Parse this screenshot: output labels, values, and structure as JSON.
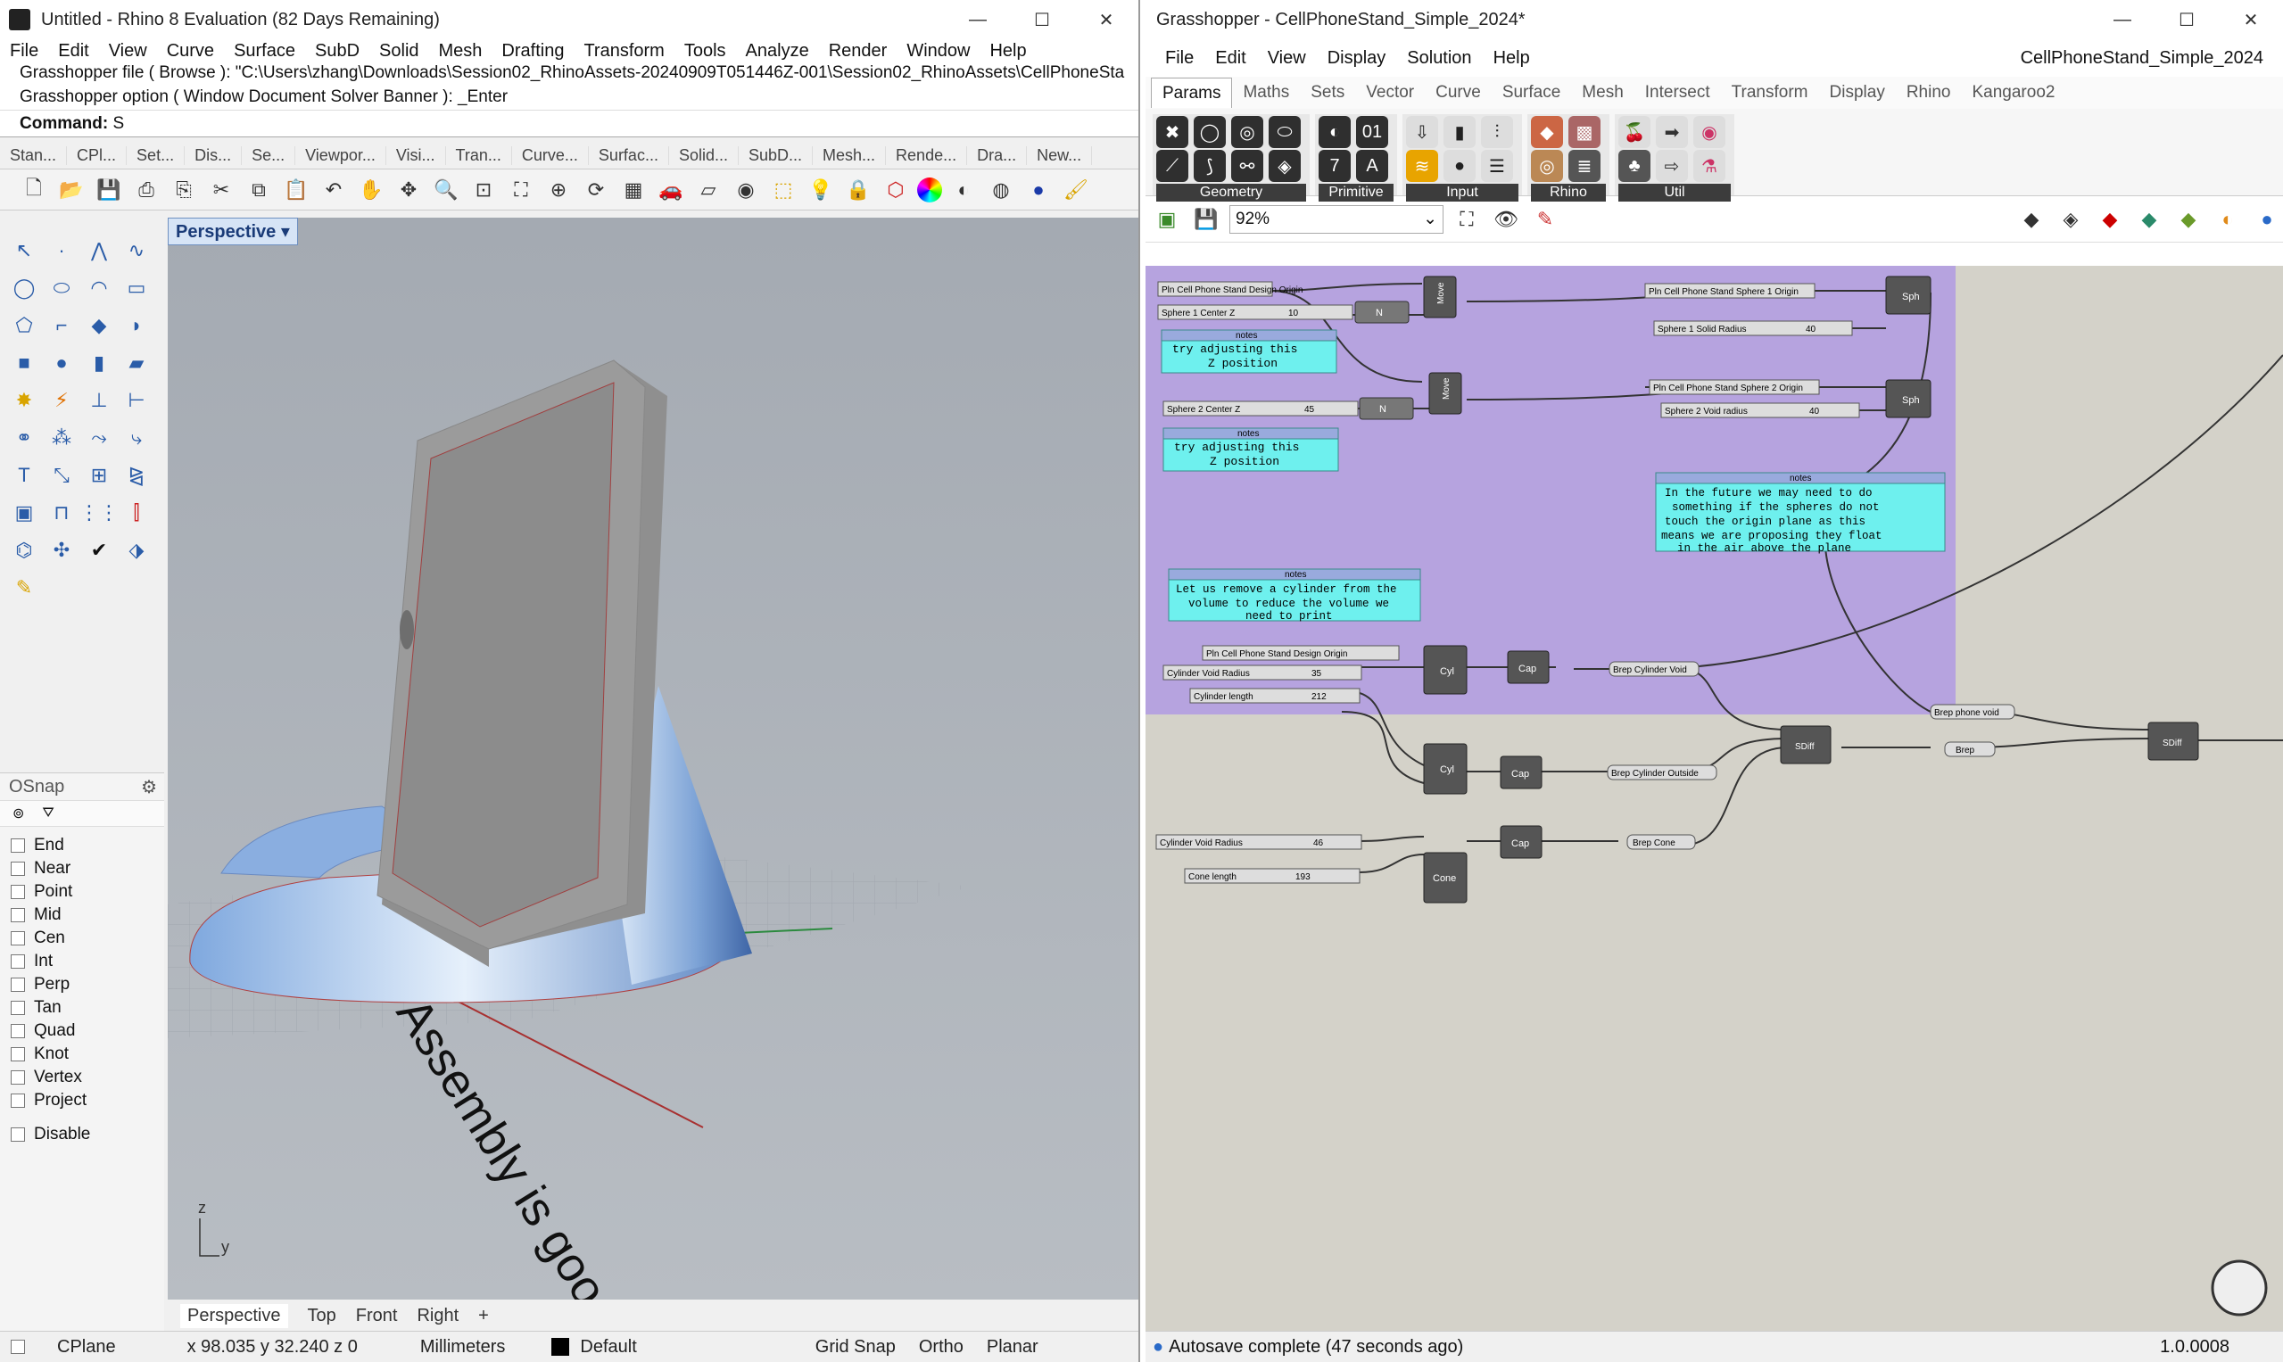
{
  "rhino": {
    "title": "Untitled - Rhino 8 Evaluation (82 Days Remaining)",
    "menu": [
      "File",
      "Edit",
      "View",
      "Curve",
      "Surface",
      "SubD",
      "Solid",
      "Mesh",
      "Drafting",
      "Transform",
      "Tools",
      "Analyze",
      "Render",
      "Window",
      "Help"
    ],
    "history_line1": "Grasshopper file ( Browse ): \"C:\\Users\\zhang\\Downloads\\Session02_RhinoAssets-20240909T051446Z-001\\Session02_RhinoAssets\\CellPhoneSta",
    "history_line2": "Grasshopper option ( Window  Document  Solver  Banner ): _Enter",
    "command_label": "Command:",
    "command_value": "S",
    "toolbar_tabs": [
      "Stan...",
      "CPl...",
      "Set...",
      "Dis...",
      "Se...",
      "Viewpor...",
      "Visi...",
      "Tran...",
      "Curve...",
      "Surfac...",
      "Solid...",
      "SubD...",
      "Mesh...",
      "Rende...",
      "Dra...",
      "New..."
    ],
    "viewport_label": "Perspective",
    "viewport_text": "Assembly is good.",
    "axis_z": "z",
    "axis_y": "y",
    "view_tabs": [
      "Perspective",
      "Top",
      "Front",
      "Right"
    ],
    "osnap": {
      "title": "OSnap",
      "items": [
        "End",
        "Near",
        "Point",
        "Mid",
        "Cen",
        "Int",
        "Perp",
        "Tan",
        "Quad",
        "Knot",
        "Vertex",
        "Project"
      ],
      "disable": "Disable"
    },
    "status": {
      "cplane": "CPlane",
      "coords": "x 98.035   y 32.240   z 0",
      "units": "Millimeters",
      "layer": "Default",
      "grid_snap": "Grid Snap",
      "ortho": "Ortho",
      "planar": "Planar"
    }
  },
  "gh": {
    "title": "Grasshopper - CellPhoneStand_Simple_2024*",
    "menu": [
      "File",
      "Edit",
      "View",
      "Display",
      "Solution",
      "Help"
    ],
    "doc_name": "CellPhoneStand_Simple_2024",
    "tabs": [
      "Params",
      "Maths",
      "Sets",
      "Vector",
      "Curve",
      "Surface",
      "Mesh",
      "Intersect",
      "Transform",
      "Display",
      "Rhino",
      "Kangaroo2"
    ],
    "panels": [
      "Geometry",
      "Primitive",
      "Input",
      "Rhino",
      "Util"
    ],
    "zoom": "92%",
    "status": "Autosave complete (47 seconds ago)",
    "version": "1.0.0008",
    "nodes": {
      "pln1": "Pln Cell Phone Stand Design Origin",
      "s1cz": "Sphere 1 Center Z",
      "s1cz_val": "10",
      "s2cz": "Sphere 2 Center Z",
      "s2cz_val": "45",
      "note_title": "notes",
      "note1": [
        "try adjusting this",
        "Z position"
      ],
      "note2": [
        "try adjusting this",
        "Z position"
      ],
      "note3": [
        "Let us remove a cylinder from the",
        "volume to reduce the volume we",
        "need to print"
      ],
      "note4": [
        "In the future we may need to do",
        "something if the spheres do not",
        "touch the origin plane as this",
        "means we are proposing they float",
        "in the air above the plane"
      ],
      "move": "Move",
      "s1origin": "Pln Cell Phone Stand Sphere 1 Origin",
      "s1radius": "Sphere 1 Solid Radius",
      "s1radius_val": "40",
      "s2origin": "Pln Cell Phone Stand Sphere 2 Origin",
      "s2radius": "Sphere 2 Void radius",
      "s2radius_val": "40",
      "sph": "Sph",
      "pln2": "Pln Cell Phone Stand Design Origin",
      "cylvoid": "Cylinder Void  Radius",
      "cylvoid_val": "35",
      "cyllen": "Cylinder length",
      "cyllen_val": "212",
      "cyl": "Cyl",
      "cap": "Cap",
      "brep_cyl_void": "Brep Cylinder Void",
      "brep_phone_void": "Brep phone void",
      "sdiff": "SDiff",
      "brep": "Brep",
      "brep_cyl_out": "Brep Cylinder Outside",
      "cylvoid2": "Cylinder Void  Radius",
      "cylvoid2_val": "46",
      "conelen": "Cone length",
      "conelen_val": "193",
      "cone": "Cone",
      "brep_cone": "Brep Cone"
    }
  }
}
